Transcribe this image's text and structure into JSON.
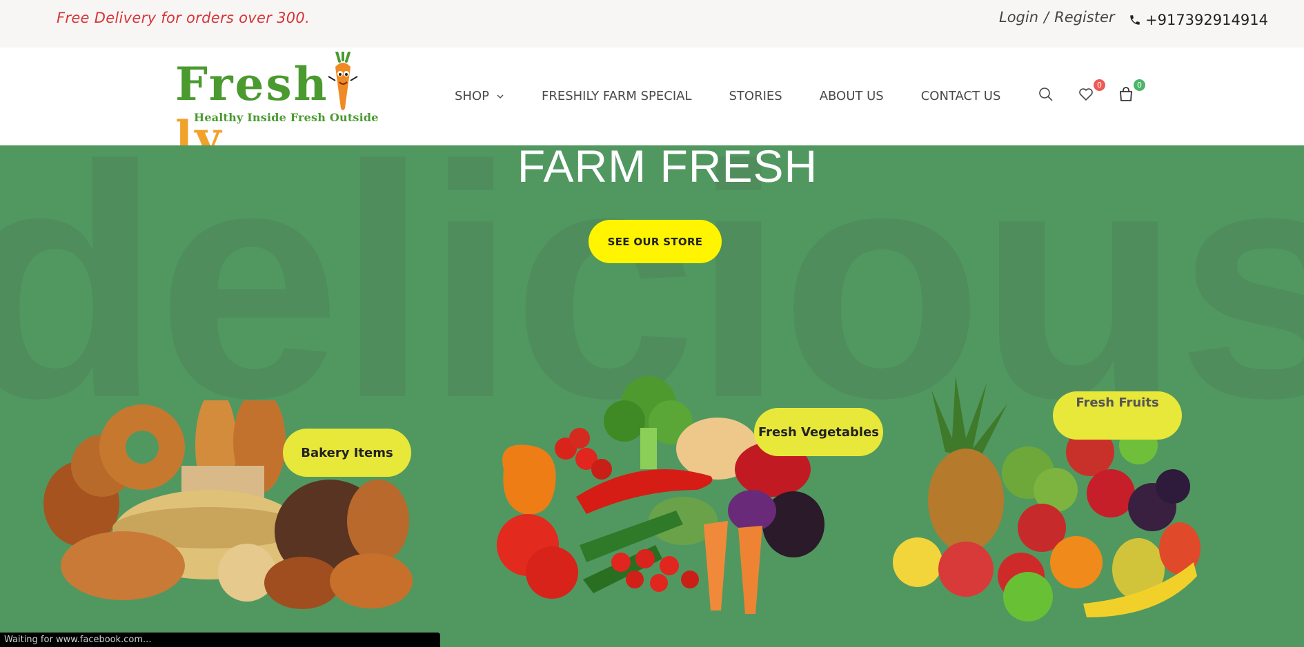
{
  "topbar": {
    "promo": "Free Delivery for orders over 300.",
    "login": "Login",
    "separator": "/",
    "register": "Register",
    "phone": "+917392914914"
  },
  "logo": {
    "word_start": "Fresh",
    "word_end": "ly",
    "tagline": "Healthy Inside Fresh Outside"
  },
  "nav": {
    "items": [
      {
        "label": "SHOP",
        "has_dropdown": true
      },
      {
        "label": "FRESHILY FARM SPECIAL"
      },
      {
        "label": "STORIES"
      },
      {
        "label": "ABOUT US"
      },
      {
        "label": "CONTACT US"
      }
    ]
  },
  "header_icons": {
    "search": "search-icon",
    "wishlist": "heart-icon",
    "wishlist_count": "0",
    "cart": "bag-icon",
    "cart_count": "0"
  },
  "hero": {
    "background_word": "delicious",
    "title": "FARM FRESH",
    "cta": "SEE OUR STORE"
  },
  "categories": [
    {
      "label": "Bakery Items",
      "image": "bread-basket-image"
    },
    {
      "label": "Fresh Vegetables",
      "image": "vegetables-image"
    },
    {
      "label": "Fresh Fruits",
      "image": "fruits-image"
    }
  ],
  "status_bar": {
    "text": "Waiting for www.facebook.com..."
  },
  "colors": {
    "hero_bg": "#519860",
    "cta": "#fff500",
    "pill": "#e8e83a",
    "promo": "#d73339",
    "brand_green": "#4a9a30",
    "brand_orange": "#f0a22a"
  }
}
